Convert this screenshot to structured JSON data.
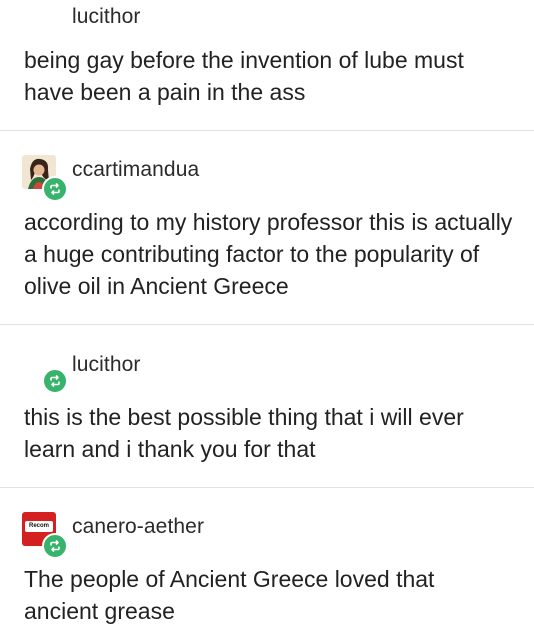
{
  "posts": [
    {
      "username": "lucithor",
      "text": "being gay before the invention of lube must have been a pain in the ass",
      "avatar": "none"
    },
    {
      "username": "ccartimandua",
      "text": "according to my history professor this is actually a huge contributing factor to the popularity of olive oil in Ancient Greece",
      "avatar": "illustrated-portrait"
    },
    {
      "username": "lucithor",
      "text": "this is the best possible thing that i will ever learn and i thank you for that",
      "avatar": "reblog-only"
    },
    {
      "username": "canero-aether",
      "text": "The people of Ancient Greece loved that ancient grease",
      "avatar": "red-square-logo",
      "avatar_badge": "Recom"
    }
  ],
  "colors": {
    "reblog_green": "#37b36b",
    "divider": "#e2e2e2",
    "text": "#222222"
  },
  "icons": {
    "reblog": "reblog-icon"
  }
}
